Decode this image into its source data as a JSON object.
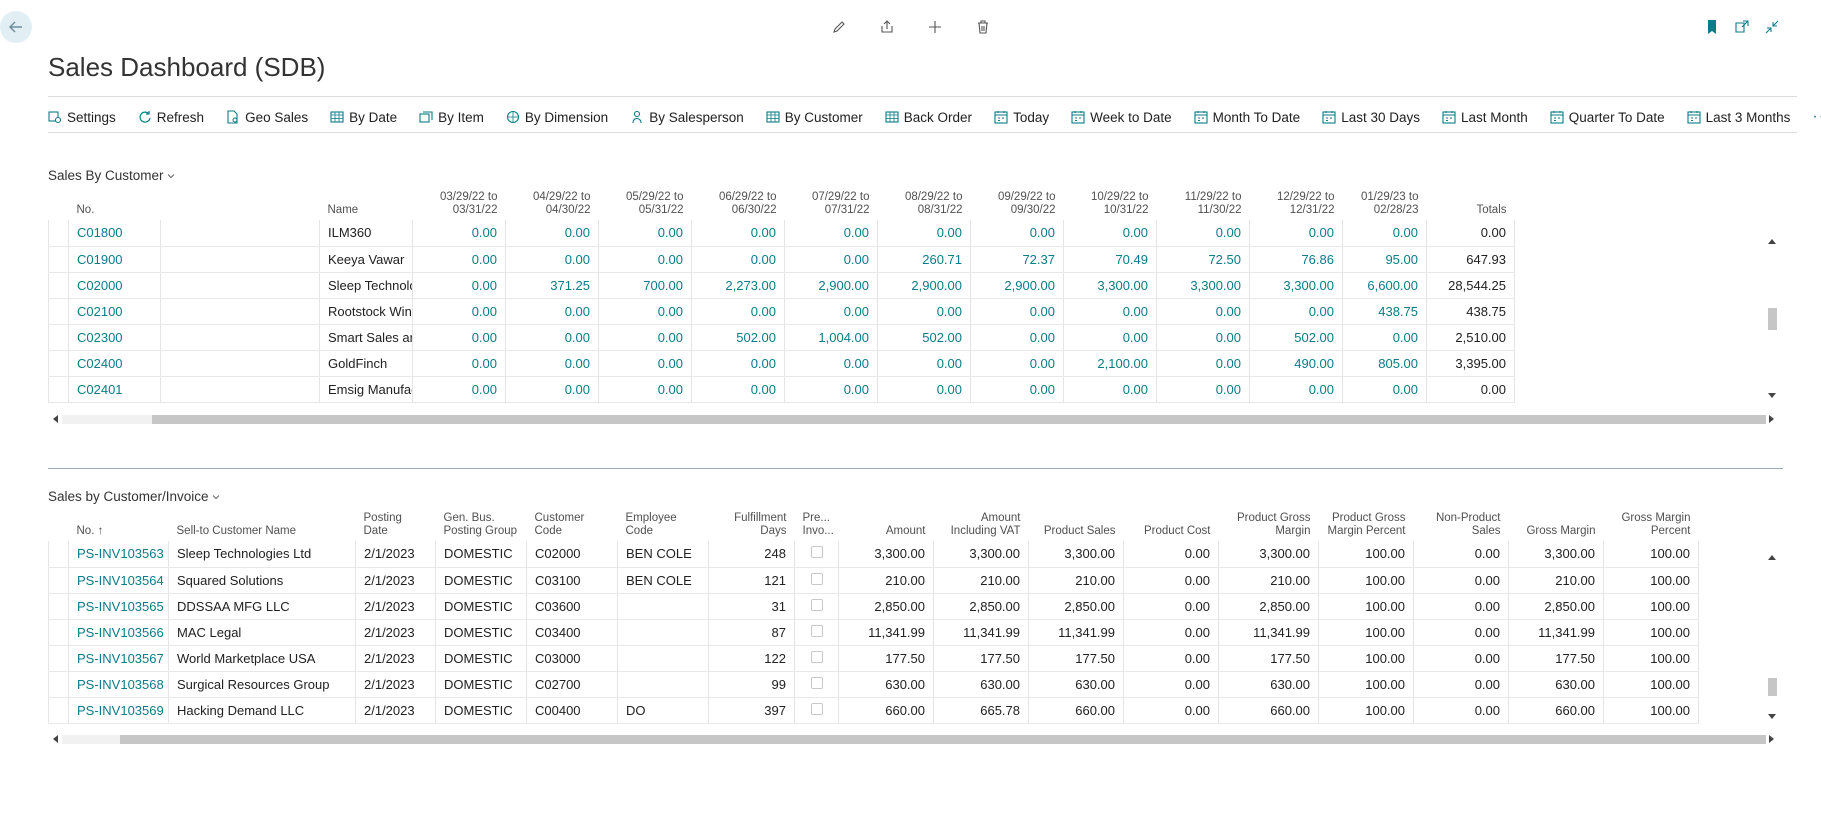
{
  "page": {
    "title": "Sales Dashboard (SDB)"
  },
  "actions": [
    {
      "label": "Settings",
      "icon": "settings-icon"
    },
    {
      "label": "Refresh",
      "icon": "refresh-icon"
    },
    {
      "label": "Geo Sales",
      "icon": "geo-icon"
    },
    {
      "label": "By Date",
      "icon": "table-icon"
    },
    {
      "label": "By Item",
      "icon": "item-icon"
    },
    {
      "label": "By Dimension",
      "icon": "dimension-icon"
    },
    {
      "label": "By Salesperson",
      "icon": "person-icon"
    },
    {
      "label": "By Customer",
      "icon": "table-icon"
    },
    {
      "label": "Back Order",
      "icon": "table-icon"
    },
    {
      "label": "Today",
      "icon": "calendar-icon"
    },
    {
      "label": "Week to Date",
      "icon": "calendar-icon"
    },
    {
      "label": "Month To Date",
      "icon": "calendar-icon"
    },
    {
      "label": "Last 30 Days",
      "icon": "calendar-icon"
    },
    {
      "label": "Last Month",
      "icon": "calendar-icon"
    },
    {
      "label": "Quarter To Date",
      "icon": "calendar-icon"
    },
    {
      "label": "Last 3 Months",
      "icon": "calendar-icon"
    }
  ],
  "more_label": "···",
  "sales_by_customer": {
    "title": "Sales By Customer",
    "headers": [
      "No.",
      "Name",
      [
        "03/29/22 to",
        "03/31/22"
      ],
      [
        "04/29/22 to",
        "04/30/22"
      ],
      [
        "05/29/22 to",
        "05/31/22"
      ],
      [
        "06/29/22 to",
        "06/30/22"
      ],
      [
        "07/29/22 to",
        "07/31/22"
      ],
      [
        "08/29/22 to",
        "08/31/22"
      ],
      [
        "09/29/22 to",
        "09/30/22"
      ],
      [
        "10/29/22 to",
        "10/31/22"
      ],
      [
        "11/29/22 to",
        "11/30/22"
      ],
      [
        "12/29/22 to",
        "12/31/22"
      ],
      [
        "01/29/23 to",
        "02/28/23"
      ],
      "Totals"
    ],
    "rows": [
      [
        "C01800",
        "ILM360",
        "0.00",
        "0.00",
        "0.00",
        "0.00",
        "0.00",
        "0.00",
        "0.00",
        "0.00",
        "0.00",
        "0.00",
        "0.00",
        "0.00"
      ],
      [
        "C01900",
        "Keeya Vawar",
        "0.00",
        "0.00",
        "0.00",
        "0.00",
        "0.00",
        "260.71",
        "72.37",
        "70.49",
        "72.50",
        "76.86",
        "95.00",
        "647.93"
      ],
      [
        "C02000",
        "Sleep Technologies Ltd",
        "0.00",
        "371.25",
        "700.00",
        "2,273.00",
        "2,900.00",
        "2,900.00",
        "2,900.00",
        "3,300.00",
        "3,300.00",
        "3,300.00",
        "6,600.00",
        "28,544.25"
      ],
      [
        "C02100",
        "Rootstock Wines",
        "0.00",
        "0.00",
        "0.00",
        "0.00",
        "0.00",
        "0.00",
        "0.00",
        "0.00",
        "0.00",
        "0.00",
        "438.75",
        "438.75"
      ],
      [
        "C02300",
        "Smart Sales and Lease",
        "0.00",
        "0.00",
        "0.00",
        "502.00",
        "1,004.00",
        "502.00",
        "0.00",
        "0.00",
        "0.00",
        "502.00",
        "0.00",
        "2,510.00"
      ],
      [
        "C02400",
        "GoldFinch",
        "0.00",
        "0.00",
        "0.00",
        "0.00",
        "0.00",
        "0.00",
        "0.00",
        "2,100.00",
        "0.00",
        "490.00",
        "805.00",
        "3,395.00"
      ],
      [
        "C02401",
        "Emsig Manufacturing Corp",
        "0.00",
        "0.00",
        "0.00",
        "0.00",
        "0.00",
        "0.00",
        "0.00",
        "0.00",
        "0.00",
        "0.00",
        "0.00",
        "0.00"
      ]
    ]
  },
  "sales_by_invoice": {
    "title": "Sales by Customer/Invoice",
    "headers": [
      [
        "No. ↑"
      ],
      [
        "Sell-to Customer Name"
      ],
      [
        "Posting Date"
      ],
      [
        "Gen. Bus.",
        "Posting Group"
      ],
      [
        "Customer",
        "Code"
      ],
      [
        "Employee",
        "Code"
      ],
      [
        "Fulfillment",
        "Days"
      ],
      [
        "Pre...",
        "Invo..."
      ],
      [
        "Amount"
      ],
      [
        "Amount",
        "Including VAT"
      ],
      [
        "Product Sales"
      ],
      [
        "Product Cost"
      ],
      [
        "Product Gross",
        "Margin"
      ],
      [
        "Product Gross",
        "Margin Percent"
      ],
      [
        "Non-Product",
        "Sales"
      ],
      [
        "Gross Margin"
      ],
      [
        "Gross Margin",
        "Percent"
      ]
    ],
    "rows": [
      [
        "PS-INV103563",
        "Sleep Technologies Ltd",
        "2/1/2023",
        "DOMESTIC",
        "C02000",
        "BEN COLE",
        "248",
        "",
        "3,300.00",
        "3,300.00",
        "3,300.00",
        "0.00",
        "3,300.00",
        "100.00",
        "0.00",
        "3,300.00",
        "100.00"
      ],
      [
        "PS-INV103564",
        "Squared Solutions",
        "2/1/2023",
        "DOMESTIC",
        "C03100",
        "BEN COLE",
        "121",
        "",
        "210.00",
        "210.00",
        "210.00",
        "0.00",
        "210.00",
        "100.00",
        "0.00",
        "210.00",
        "100.00"
      ],
      [
        "PS-INV103565",
        "DDSSAA MFG LLC",
        "2/1/2023",
        "DOMESTIC",
        "C03600",
        "",
        "31",
        "",
        "2,850.00",
        "2,850.00",
        "2,850.00",
        "0.00",
        "2,850.00",
        "100.00",
        "0.00",
        "2,850.00",
        "100.00"
      ],
      [
        "PS-INV103566",
        "MAC Legal",
        "2/1/2023",
        "DOMESTIC",
        "C03400",
        "",
        "87",
        "",
        "11,341.99",
        "11,341.99",
        "11,341.99",
        "0.00",
        "11,341.99",
        "100.00",
        "0.00",
        "11,341.99",
        "100.00"
      ],
      [
        "PS-INV103567",
        "World Marketplace USA",
        "2/1/2023",
        "DOMESTIC",
        "C03000",
        "",
        "122",
        "",
        "177.50",
        "177.50",
        "177.50",
        "0.00",
        "177.50",
        "100.00",
        "0.00",
        "177.50",
        "100.00"
      ],
      [
        "PS-INV103568",
        "Surgical Resources Group",
        "2/1/2023",
        "DOMESTIC",
        "C02700",
        "",
        "99",
        "",
        "630.00",
        "630.00",
        "630.00",
        "0.00",
        "630.00",
        "100.00",
        "0.00",
        "630.00",
        "100.00"
      ],
      [
        "PS-INV103569",
        "Hacking Demand LLC",
        "2/1/2023",
        "DOMESTIC",
        "C00400",
        "DO",
        "397",
        "",
        "660.00",
        "665.78",
        "660.00",
        "0.00",
        "660.00",
        "100.00",
        "0.00",
        "660.00",
        "100.00"
      ]
    ]
  },
  "colors": {
    "link": "#0a7c87",
    "accent": "#0a7c87",
    "back_bg": "#e1eef4"
  }
}
